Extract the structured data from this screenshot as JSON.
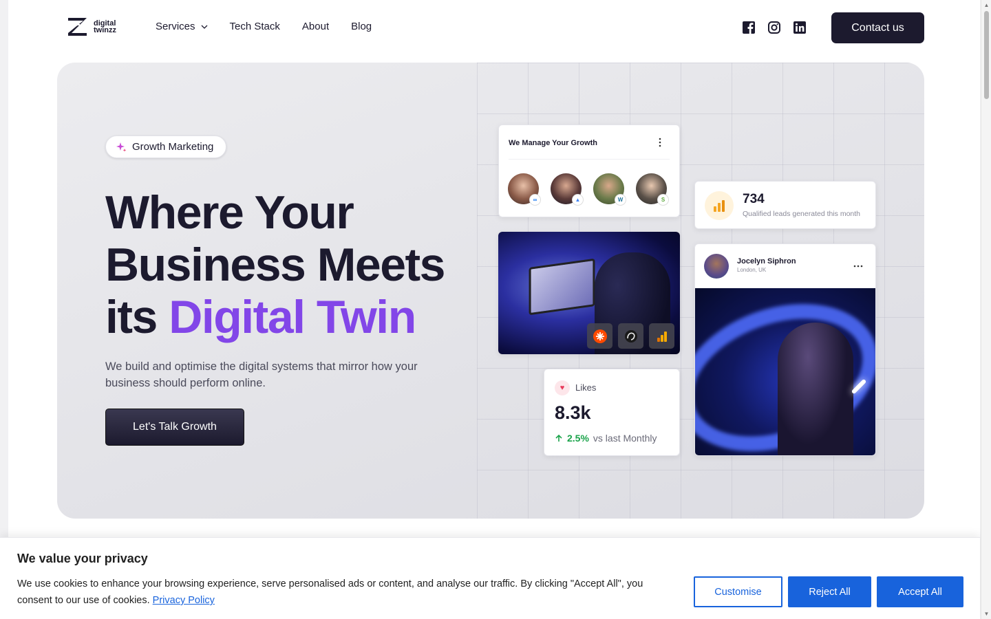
{
  "header": {
    "logo": {
      "line1": "digital",
      "line2": "twinzz"
    },
    "nav": [
      {
        "label": "Services",
        "has_dropdown": true
      },
      {
        "label": "Tech Stack"
      },
      {
        "label": "About"
      },
      {
        "label": "Blog"
      }
    ],
    "socials": [
      "facebook-icon",
      "instagram-icon",
      "linkedin-icon"
    ],
    "contact_label": "Contact us"
  },
  "hero": {
    "badge": "Growth Marketing",
    "headline_line1": "Where Your",
    "headline_line2": "Business Meets",
    "headline_line3_plain": "its ",
    "headline_line3_accent": "Digital Twin",
    "subtext": "We build and optimise the digital systems that mirror how your business should perform online.",
    "cta_label": "Let's Talk Growth",
    "accent_color": "#8246e8",
    "dark_color": "#1c1a2e"
  },
  "cards": {
    "manage": {
      "title": "We Manage Your Growth",
      "platforms": [
        "meta",
        "google-ads",
        "wordpress",
        "shopify"
      ]
    },
    "leads": {
      "value": "734",
      "label": "Qualified leads generated this month"
    },
    "profile": {
      "name": "Jocelyn Siphron",
      "location": "London, UK"
    },
    "likes": {
      "label": "Likes",
      "value": "8.3k",
      "change": "2.5%",
      "change_suffix": "vs last Monthly"
    },
    "tools": [
      "zapier-icon",
      "mailchimp-icon",
      "google-analytics-icon"
    ]
  },
  "cookie": {
    "title": "We value your privacy",
    "text": "We use cookies to enhance your browsing experience, serve personalised ads or content, and analyse our traffic. By clicking \"Accept All\", you consent to our use of cookies. ",
    "link": "Privacy Policy",
    "customise": "Customise",
    "reject": "Reject All",
    "accept": "Accept All",
    "button_color": "#1863dc"
  }
}
